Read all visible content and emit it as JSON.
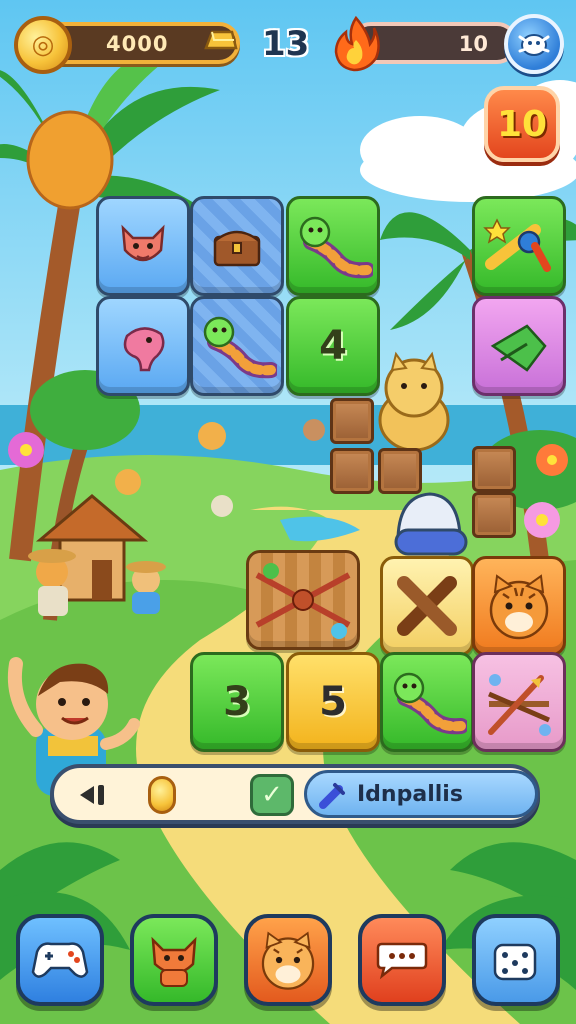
{
  "hud": {
    "coins": "4000",
    "level": "13",
    "streak": "10",
    "timer": "10"
  },
  "action_bar": {
    "search_label": "Idnpallis"
  },
  "tiles": {
    "t1": "4",
    "t2": "3",
    "t3": "5"
  },
  "icons": {
    "coin": "coin-icon",
    "gold_bar": "gold-bar-icon",
    "fire": "fire-icon",
    "menu": "bug-icon",
    "back": "speaker-icon",
    "check": "check-icon",
    "search": "brush-icon"
  },
  "nav": {
    "items": [
      "gamepad",
      "fox",
      "tiger",
      "chat",
      "dice"
    ]
  },
  "colors": {
    "sky": "#8fd8f5",
    "grass": "#7ed35a",
    "path": "#f5dc7a",
    "accent_orange": "#e3461e",
    "accent_blue": "#2f7ed8"
  }
}
